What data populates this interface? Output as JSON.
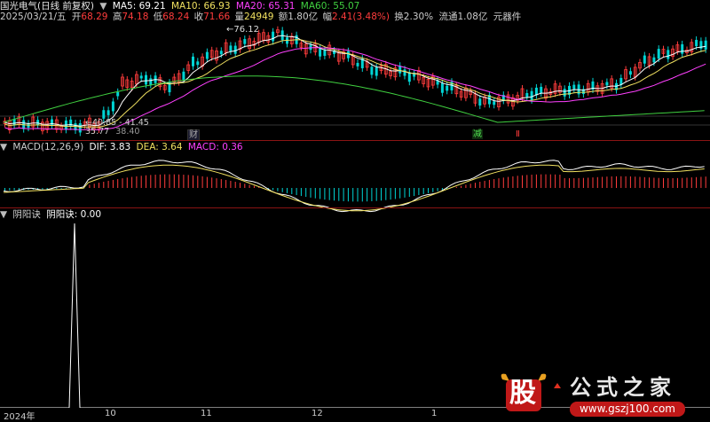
{
  "header": {
    "stock": "国光电气(日线 前复权)",
    "ma5": "MA5: 69.21",
    "ma10": "MA10: 66.93",
    "ma20": "MA20: 65.31",
    "ma60": "MA60: 55.07",
    "date": "2025/03/21/五",
    "open_label": "开",
    "open_val": "68.29",
    "high_label": "高",
    "high_val": "74.18",
    "low_label": "低",
    "low_val": "68.24",
    "close_label": "收",
    "close_val": "71.66",
    "vol_label": "量",
    "vol_val": "24949",
    "amt_label": "额",
    "amt_val": "1.80亿",
    "chg_label": "幅",
    "chg_val": "2.41(3.48%)",
    "turn": "换2.30%",
    "float": "流通1.08亿",
    "sector": "元器件"
  },
  "price_panel": {
    "peak_label": "76.12",
    "low_label_1": "40.85 - 41.45",
    "low_label_2": "35.77",
    "low_label_3": "38.40",
    "markers": [
      "财",
      "减",
      "Ⅱ"
    ]
  },
  "macd_panel": {
    "title": "MACD(12,26,9)",
    "dif": "DIF: 3.83",
    "dea": "DEA: 3.64",
    "macd": "MACD: 0.36"
  },
  "indicator_panel": {
    "title": "阴阳诀",
    "value": "阴阳诀: 0.00"
  },
  "time_axis": {
    "labels": [
      "2024年",
      "10",
      "11",
      "12",
      "1"
    ]
  },
  "watermark": {
    "logo_char": "股",
    "brand": "公式之家",
    "url": "www.gszj100.com"
  },
  "colors": {
    "up": "#ff3c3c",
    "down": "#00d4d4",
    "ma5": "#ffffff",
    "ma10": "#f0e060",
    "ma20": "#ff40ff",
    "ma60": "#40d040",
    "separator": "#8a1414"
  }
}
